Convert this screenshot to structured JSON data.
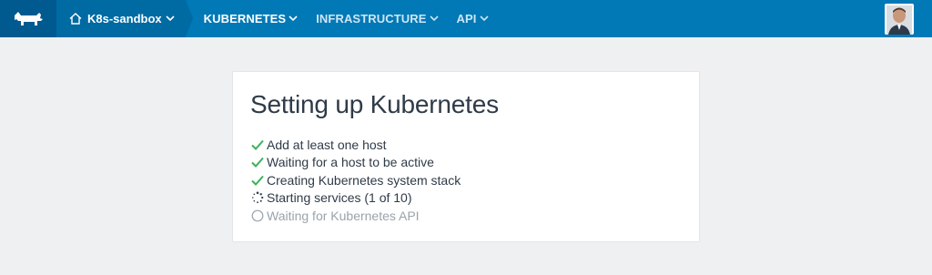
{
  "nav": {
    "environment": "K8s-sandbox",
    "items": [
      {
        "label": "KUBERNETES",
        "active": true
      },
      {
        "label": "INFRASTRUCTURE",
        "active": false
      },
      {
        "label": "API",
        "active": false
      }
    ]
  },
  "icons": {
    "logo": "rancher-logo-icon",
    "home": "home-icon",
    "chevron": "chevron-down-icon",
    "done": "check-icon",
    "in_progress": "spinner-icon",
    "pending": "circle-icon"
  },
  "colors": {
    "topbar": "#0079b6",
    "check": "#3ab25a",
    "pending_text": "#9aa3ab"
  },
  "card": {
    "title": "Setting up Kubernetes",
    "steps": [
      {
        "label": "Add at least one host",
        "status": "done"
      },
      {
        "label": "Waiting for a host to be active",
        "status": "done"
      },
      {
        "label": "Creating Kubernetes system stack",
        "status": "done"
      },
      {
        "label": "Starting services (1 of 10)",
        "status": "in-progress"
      },
      {
        "label": "Waiting for Kubernetes API",
        "status": "pending"
      }
    ]
  }
}
